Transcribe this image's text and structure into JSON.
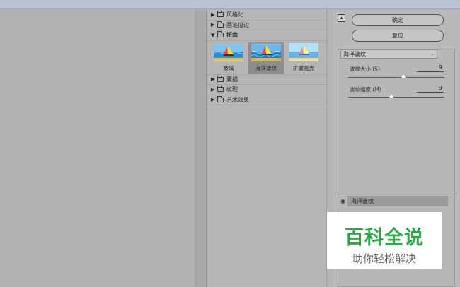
{
  "gallery": {
    "categories_top": [
      {
        "label": "风格化",
        "open": false
      },
      {
        "label": "画笔描边",
        "open": false
      },
      {
        "label": "扭曲",
        "open": true
      }
    ],
    "thumbnails": [
      {
        "label": "玻璃",
        "selected": false
      },
      {
        "label": "海洋波纹",
        "selected": true
      },
      {
        "label": "扩散亮光",
        "selected": false
      }
    ],
    "categories_bottom": [
      {
        "label": "素描",
        "open": false
      },
      {
        "label": "纹理",
        "open": false
      },
      {
        "label": "艺术效果",
        "open": false
      }
    ]
  },
  "controls": {
    "ok_label": "确定",
    "reset_label": "复位",
    "filter_select": "海洋波纹",
    "params": [
      {
        "label": "波纹大小 (S)",
        "value": "9",
        "fraction": 0.6
      },
      {
        "label": "波纹幅度 (M)",
        "value": "9",
        "fraction": 0.45
      }
    ]
  },
  "layers": {
    "active_layer": "海洋波纹"
  },
  "watermark": {
    "title": "百科全说",
    "subtitle": "助你轻松解决"
  },
  "colors": {
    "watermark_green": "#2ea64a",
    "sea": "#2a8fd1",
    "sand": "#d9c47a"
  },
  "icons": {
    "expanded": "triangle-down",
    "collapsed": "triangle-right",
    "folder": "folder-icon",
    "eye": "eye-icon"
  }
}
